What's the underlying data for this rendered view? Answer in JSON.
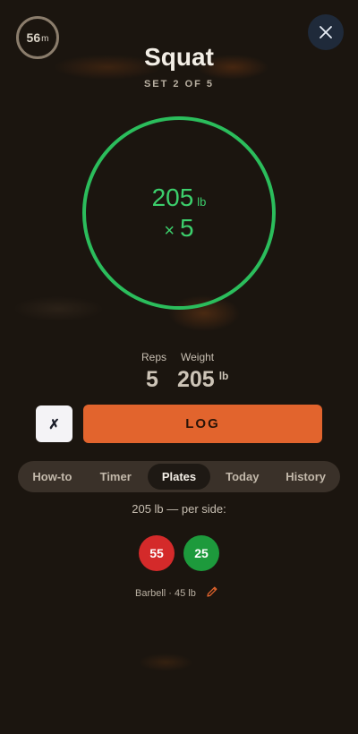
{
  "header": {
    "timer_value": "56",
    "timer_unit": "m",
    "close_icon": "close-icon"
  },
  "exercise": {
    "name": "Squat",
    "set_label": "SET 2 OF 5"
  },
  "ring": {
    "weight": "205",
    "weight_unit": "lb",
    "reps_prefix": "×",
    "reps": "5",
    "color": "#2bbd5c"
  },
  "inputs": {
    "reps_label": "Reps",
    "weight_label": "Weight",
    "reps_value": "5",
    "weight_value": "205",
    "weight_unit": "lb"
  },
  "actions": {
    "skip_label": "✗",
    "log_label": "LOG",
    "log_color": "#e2642d"
  },
  "tabs": [
    {
      "label": "How-to",
      "active": false
    },
    {
      "label": "Timer",
      "active": false
    },
    {
      "label": "Plates",
      "active": true
    },
    {
      "label": "Today",
      "active": false
    },
    {
      "label": "History",
      "active": false
    }
  ],
  "plates": {
    "per_side_text": "205 lb — per side:",
    "items": [
      {
        "value": "55",
        "color": "#d42a2a"
      },
      {
        "value": "25",
        "color": "#1d9a3c"
      }
    ],
    "barbell_text": "Barbell · 45 lb",
    "edit_icon": "pencil-icon"
  }
}
